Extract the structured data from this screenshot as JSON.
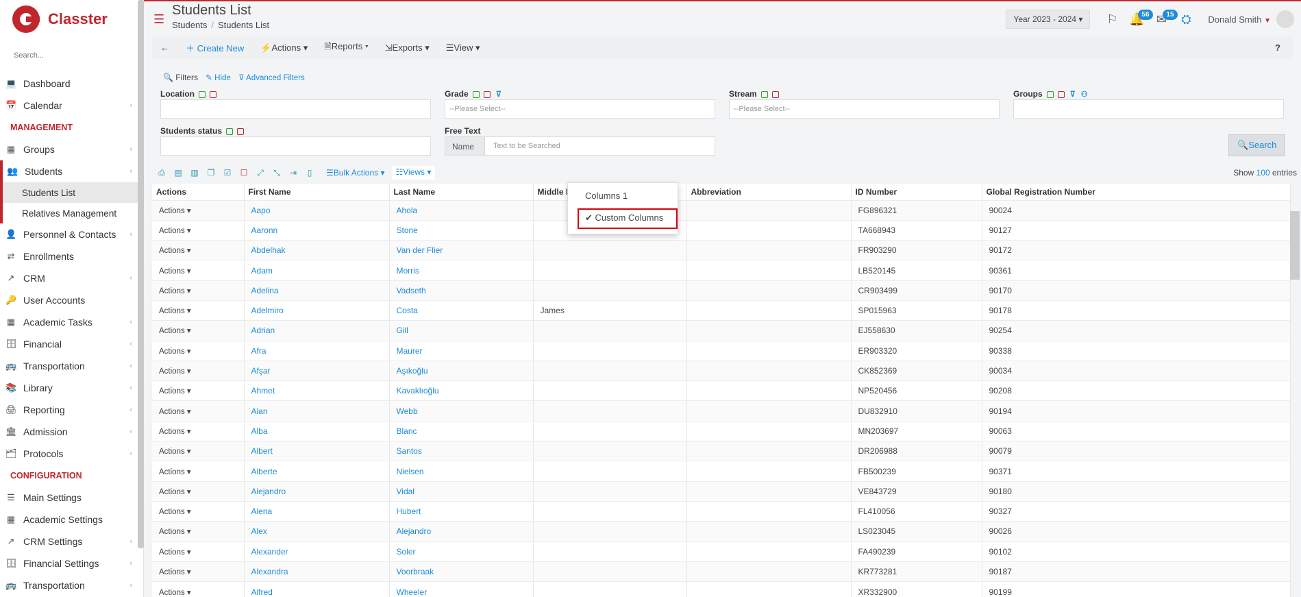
{
  "app": {
    "brand": "Classter",
    "search_placeholder": "Search..."
  },
  "sidebar": {
    "items": [
      {
        "label": "Dashboard",
        "icon": "laptop-icon"
      },
      {
        "label": "Calendar",
        "icon": "calendar-icon"
      }
    ],
    "section_management": "MANAGEMENT",
    "mgmt": [
      {
        "label": "Groups",
        "icon": "groups-icon"
      },
      {
        "label": "Students",
        "icon": "students-icon"
      }
    ],
    "students_sub": [
      "Students List",
      "Relatives Management"
    ],
    "mgmt2": [
      {
        "label": "Personnel & Contacts"
      },
      {
        "label": "Enrollments"
      },
      {
        "label": "CRM"
      },
      {
        "label": "User Accounts"
      },
      {
        "label": "Academic Tasks"
      },
      {
        "label": "Financial"
      },
      {
        "label": "Transportation"
      },
      {
        "label": "Library"
      },
      {
        "label": "Reporting"
      },
      {
        "label": "Admission"
      },
      {
        "label": "Protocols"
      }
    ],
    "section_configuration": "CONFIGURATION",
    "config": [
      {
        "label": "Main Settings"
      },
      {
        "label": "Academic Settings"
      },
      {
        "label": "CRM Settings"
      },
      {
        "label": "Financial Settings"
      },
      {
        "label": "Transportation"
      }
    ]
  },
  "header": {
    "title": "Students List",
    "breadcrumb": [
      "Students",
      "Students List"
    ],
    "year": "Year 2023 - 2024",
    "badge_notifications": "56",
    "badge_messages": "15",
    "user": "Donald Smith"
  },
  "toolbar": {
    "create": "Create New",
    "actions": "Actions",
    "reports": "Reports",
    "exports": "Exports",
    "view": "View",
    "help": "?"
  },
  "filters": {
    "title": "Filters",
    "hide": "Hide",
    "advanced": "Advanced Filters",
    "location": "Location",
    "grade": "Grade",
    "stream": "Stream",
    "groups": "Groups",
    "students_status": "Students status",
    "free_text": "Free Text",
    "please_select": "--Please Select--",
    "name_addon": "Name",
    "text_placeholder": "Text to be Searched",
    "search": "Search"
  },
  "table_tools": {
    "bulk": "Bulk Actions",
    "views": "Views",
    "show": "Show",
    "show_count": "100",
    "entries": "entries"
  },
  "views_menu": {
    "item1": "Columns 1",
    "item2": "Custom Columns"
  },
  "table": {
    "columns": [
      "Actions",
      "First Name",
      "Last Name",
      "Middle Name",
      "Abbreviation",
      "ID Number",
      "Global Registration Number"
    ],
    "action_label": "Actions",
    "rows": [
      [
        "Aapo",
        "Ahola",
        "",
        "",
        "FG896321",
        "90024"
      ],
      [
        "Aaronn",
        "Stone",
        "",
        "",
        "TA668943",
        "90127"
      ],
      [
        "Abdelhak",
        "Van der Flier",
        "",
        "",
        "FR903290",
        "90172"
      ],
      [
        "Adam",
        "Morris",
        "",
        "",
        "LB520145",
        "90361"
      ],
      [
        "Adelina",
        "Vadseth",
        "",
        "",
        "CR903499",
        "90170"
      ],
      [
        "Adelmiro",
        "Costa",
        "James",
        "",
        "SP015963",
        "90178"
      ],
      [
        "Adrian",
        "Gill",
        "",
        "",
        "EJ558630",
        "90254"
      ],
      [
        "Afra",
        "Maurer",
        "",
        "",
        "ER903320",
        "90338"
      ],
      [
        "Afşar",
        "Aşıkoğlu",
        "",
        "",
        "CK852369",
        "90034"
      ],
      [
        "Ahmet",
        "Kavaklıoğlu",
        "",
        "",
        "NP520456",
        "90208"
      ],
      [
        "Alan",
        "Webb",
        "",
        "",
        "DU832910",
        "90194"
      ],
      [
        "Alba",
        "Blanc",
        "",
        "",
        "MN203697",
        "90063"
      ],
      [
        "Albert",
        "Santos",
        "",
        "",
        "DR206988",
        "90079"
      ],
      [
        "Alberte",
        "Nielsen",
        "",
        "",
        "FB500239",
        "90371"
      ],
      [
        "Alejandro",
        "Vidal",
        "",
        "",
        "VE843729",
        "90180"
      ],
      [
        "Alena",
        "Hubert",
        "",
        "",
        "FL410056",
        "90327"
      ],
      [
        "Alex",
        "Alejandro",
        "",
        "",
        "LS023045",
        "90026"
      ],
      [
        "Alexander",
        "Soler",
        "",
        "",
        "FA490239",
        "90102"
      ],
      [
        "Alexandra",
        "Voorbraak",
        "",
        "",
        "KR773281",
        "90187"
      ],
      [
        "Alfred",
        "Wheeler",
        "",
        "",
        "XR332900",
        "90199"
      ]
    ]
  },
  "colors": {
    "brand": "#c0272d",
    "link": "#1e8cd6"
  }
}
